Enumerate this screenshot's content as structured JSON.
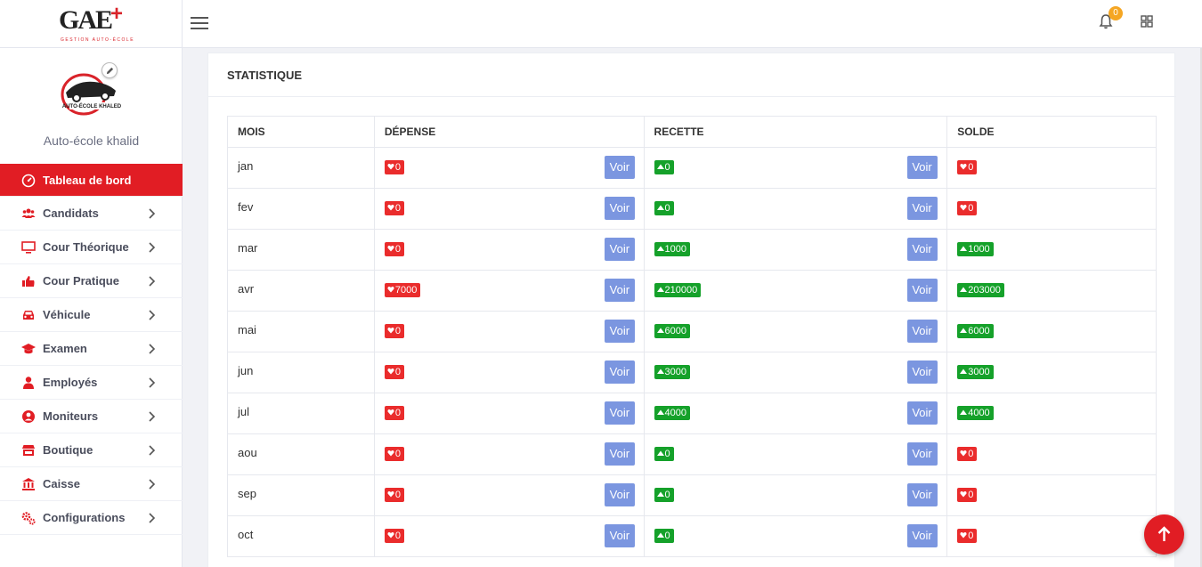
{
  "header": {
    "logo_text": "GAE",
    "logo_subtitle": "GESTION AUTO-ÉCOLE",
    "notification_count": "0"
  },
  "sidebar": {
    "school_name": "Auto-école khalid",
    "profile_logo_text": "AUTO-ÉCOLE KHALED",
    "items": [
      {
        "label": "Tableau de bord",
        "icon": "dashboard-icon",
        "active": true
      },
      {
        "label": "Candidats",
        "icon": "users-icon"
      },
      {
        "label": "Cour Théorique",
        "icon": "monitor-icon"
      },
      {
        "label": "Cour Pratique",
        "icon": "thumbs-up-icon"
      },
      {
        "label": "Véhicule",
        "icon": "car-icon"
      },
      {
        "label": "Examen",
        "icon": "graduation-cap-icon"
      },
      {
        "label": "Employés",
        "icon": "user-icon"
      },
      {
        "label": "Moniteurs",
        "icon": "user-circle-icon"
      },
      {
        "label": "Boutique",
        "icon": "store-icon"
      },
      {
        "label": "Caisse",
        "icon": "bank-icon"
      },
      {
        "label": "Configurations",
        "icon": "cogs-icon"
      }
    ]
  },
  "card": {
    "title": "STATISTIQUE",
    "columns": [
      "MOIS",
      "DÉPENSE",
      "RECETTE",
      "SOLDE"
    ],
    "voir_label": "Voir",
    "colors": {
      "down": "#ea2c2c",
      "up": "#15a12a",
      "voir": "#7b96e0",
      "accent": "#e11d24"
    },
    "rows": [
      {
        "mois": "jan",
        "depense": "0",
        "recette": "0",
        "solde": "0",
        "solde_up": false
      },
      {
        "mois": "fev",
        "depense": "0",
        "recette": "0",
        "solde": "0",
        "solde_up": false
      },
      {
        "mois": "mar",
        "depense": "0",
        "recette": "1000",
        "solde": "1000",
        "solde_up": true
      },
      {
        "mois": "avr",
        "depense": "7000",
        "recette": "210000",
        "solde": "203000",
        "solde_up": true
      },
      {
        "mois": "mai",
        "depense": "0",
        "recette": "6000",
        "solde": "6000",
        "solde_up": true
      },
      {
        "mois": "jun",
        "depense": "0",
        "recette": "3000",
        "solde": "3000",
        "solde_up": true
      },
      {
        "mois": "jul",
        "depense": "0",
        "recette": "4000",
        "solde": "4000",
        "solde_up": true
      },
      {
        "mois": "aou",
        "depense": "0",
        "recette": "0",
        "solde": "0",
        "solde_up": false
      },
      {
        "mois": "sep",
        "depense": "0",
        "recette": "0",
        "solde": "0",
        "solde_up": false
      },
      {
        "mois": "oct",
        "depense": "0",
        "recette": "0",
        "solde": "0",
        "solde_up": false
      }
    ]
  }
}
